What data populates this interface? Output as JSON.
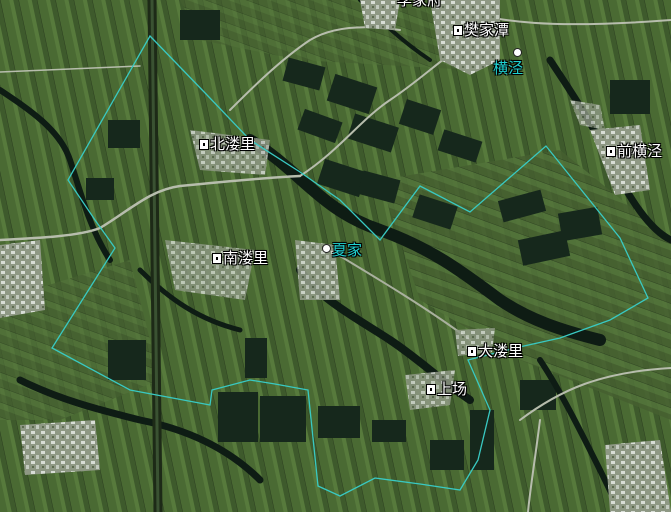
{
  "map": {
    "labels": {
      "top_cut": "李家府",
      "fanjiatan": "樊家潭",
      "hengjing": "横泾",
      "qianhengjing": "前横泾",
      "beilouli": "北溇里",
      "xiajia": "夏家",
      "nanlouli": "南溇里",
      "dalouli": "大溇里",
      "shangchang": "上场"
    },
    "colors": {
      "boundary": "#39c9c2",
      "village_label": "#1fd2d2",
      "place_label": "#ffffff",
      "water": "#11231a"
    },
    "icons": {
      "place_marker": "square-pin-icon",
      "village_marker": "circle-dot-icon"
    }
  }
}
